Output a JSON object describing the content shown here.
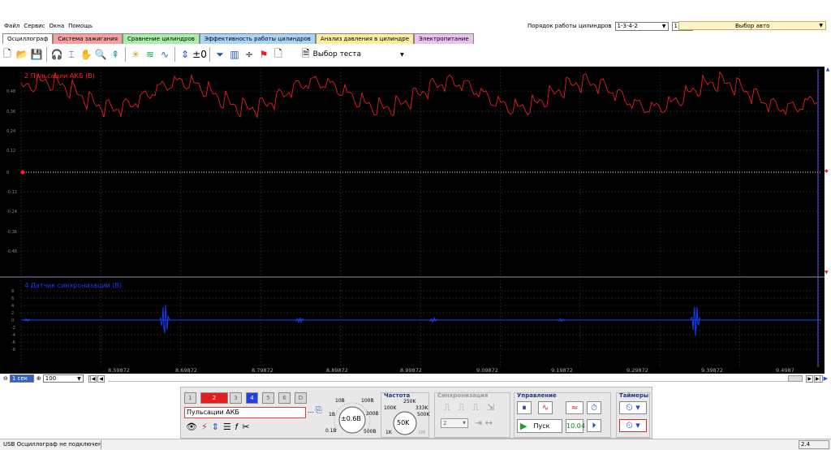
{
  "menu": [
    "Файл",
    "Сервис",
    "Окна",
    "Помощь"
  ],
  "cylinder_order": {
    "label": "Порядок работы цилиндров",
    "value": "1-3-4-2",
    "num": "1"
  },
  "car_select": "Выбор авто",
  "tabs": [
    {
      "label": "Осциллограф",
      "bg": "#ffffff"
    },
    {
      "label": "Система зажигания",
      "bg": "#f7a0a0"
    },
    {
      "label": "Сравнение цилиндров",
      "bg": "#a8eea8"
    },
    {
      "label": "Эффективность работы цилиндров",
      "bg": "#a8d4f8"
    },
    {
      "label": "Анализ давления в цилиндре",
      "bg": "#f8f0a0"
    },
    {
      "label": "Электропитание",
      "bg": "#ecc0f0"
    }
  ],
  "test_select": "Выбор теста",
  "chart_data": {
    "type": "line",
    "panels": [
      {
        "label": "2 Пульсации АКБ (В)",
        "color": "#ff2020",
        "yticks": [
          "0.48",
          "0.36",
          "0.24",
          "0.12",
          "0",
          "-0.12",
          "-0.24",
          "-0.36",
          "-0.48"
        ]
      },
      {
        "label": "4 Датчик синхронизации (В)",
        "color": "#1040ff",
        "yticks": [
          "8",
          "6",
          "4",
          "2",
          "0",
          "-2",
          "-4",
          "-6",
          "-8"
        ]
      }
    ],
    "xticks": [
      "8.59872",
      "8.69872",
      "8.79872",
      "8.89872",
      "8.99872",
      "9.09872",
      "9.19872",
      "9.29872",
      "9.39872",
      "9.4987"
    ],
    "colors": {
      "background": "#000000",
      "grid": "#3a3a3a"
    }
  },
  "timebar": {
    "scale": "1 сек",
    "zoom": "100"
  },
  "panel": {
    "channels": [
      "1",
      "2",
      "3",
      "4",
      "5",
      "6",
      "D"
    ],
    "channel_name": "Пульсации АКБ",
    "knob1": {
      "value": "±0.6В",
      "labels": [
        "10В",
        "100В",
        "1В",
        "200В",
        "0.1В",
        "500В"
      ]
    },
    "freq": {
      "title": "Частота",
      "value": "50K",
      "labels": [
        "250K",
        "100K",
        "333K",
        "500K",
        "1K",
        "1M"
      ]
    },
    "sync": {
      "title": "Синхронизация",
      "value": "2"
    },
    "control": {
      "title": "Управление",
      "start": "Пуск",
      "value": "10.04"
    },
    "timers": {
      "title": "Таймеры"
    }
  },
  "status": {
    "text": "USB Осциллограф не подключен",
    "right": "2.4"
  }
}
